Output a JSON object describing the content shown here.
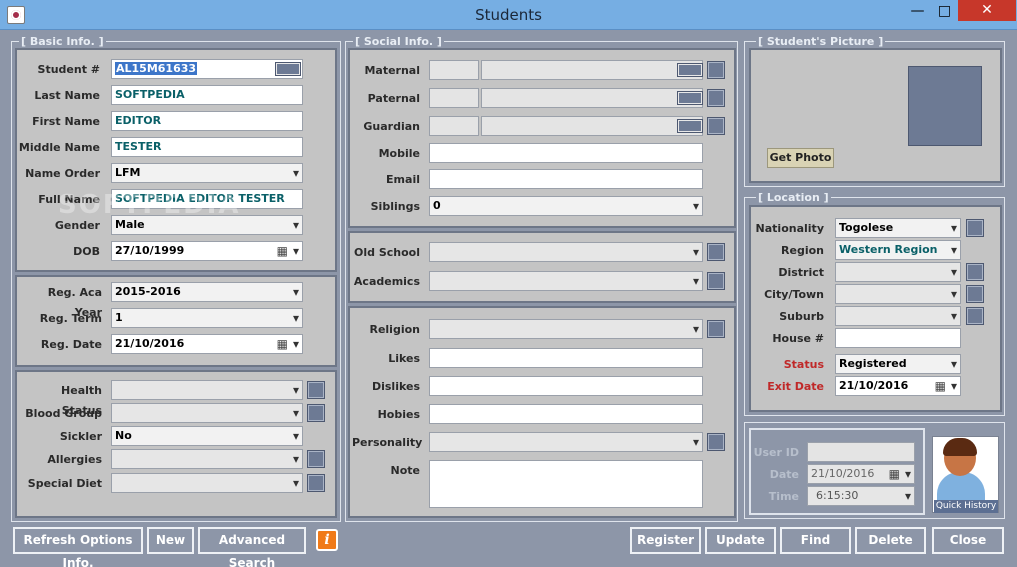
{
  "window": {
    "title": "Students",
    "minimize": "—",
    "maximize": "□",
    "close": "✕"
  },
  "basic": {
    "group": "[ Basic Info. ]",
    "student_no_label": "Student #",
    "student_no": "AL15M61633",
    "last_name_label": "Last Name",
    "last_name": "SOFTPEDIA",
    "first_name_label": "First Name",
    "first_name": "EDITOR",
    "middle_name_label": "Middle Name",
    "middle_name": "TESTER",
    "name_order_label": "Name Order",
    "name_order": "LFM",
    "full_name_label": "Full Name",
    "full_name": "SOFTPEDIA EDITOR TESTER",
    "gender_label": "Gender",
    "gender": "Male",
    "dob_label": "DOB",
    "dob": "27/10/1999",
    "reg_year_label": "Reg. Aca Year",
    "reg_year": "2015-2016",
    "reg_term_label": "Reg. Term",
    "reg_term": "1",
    "reg_date_label": "Reg. Date",
    "reg_date": "21/10/2016",
    "health_label": "Health Status",
    "health": "",
    "blood_label": "Blood Group",
    "blood": "",
    "sickler_label": "Sickler",
    "sickler": "No",
    "allergies_label": "Allergies",
    "allergies": "",
    "diet_label": "Special Diet",
    "diet": ""
  },
  "social": {
    "group": "[ Social Info. ]",
    "maternal_label": "Maternal",
    "paternal_label": "Paternal",
    "guardian_label": "Guardian",
    "mobile_label": "Mobile",
    "email_label": "Email",
    "siblings_label": "Siblings",
    "siblings": "0",
    "old_school_label": "Old School",
    "academics_label": "Academics",
    "religion_label": "Religion",
    "likes_label": "Likes",
    "dislikes_label": "Dislikes",
    "hobies_label": "Hobies",
    "personality_label": "Personality",
    "note_label": "Note"
  },
  "picture": {
    "group": "[ Student's Picture ]",
    "get_photo": "Get Photo"
  },
  "location": {
    "group": "[ Location ]",
    "nationality_label": "Nationality",
    "nationality": "Togolese",
    "region_label": "Region",
    "region": "Western Region",
    "district_label": "District",
    "city_label": "City/Town",
    "suburb_label": "Suburb",
    "house_label": "House #",
    "status_label": "Status",
    "status": "Registered",
    "exit_label": "Exit Date",
    "exit_date": "21/10/2016"
  },
  "audit": {
    "user_label": "User ID",
    "user": "",
    "date_label": "Date",
    "date": "21/10/2016",
    "time_label": "Time",
    "time": "6:15:30",
    "quick_history": "Quick History"
  },
  "watermark": "SOFTPEDIA",
  "buttons": {
    "refresh": "Refresh Options Info.",
    "new": "New",
    "advanced": "Advanced Search",
    "info": "i",
    "register": "Register",
    "update": "Update",
    "find": "Find",
    "delete": "Delete",
    "close": "Close"
  },
  "colors": {
    "accent": "#76aee3",
    "panel": "#c4c4c4",
    "frame": "#8d96a8",
    "value_text": "#0a6068",
    "warning_label": "#c02828"
  }
}
